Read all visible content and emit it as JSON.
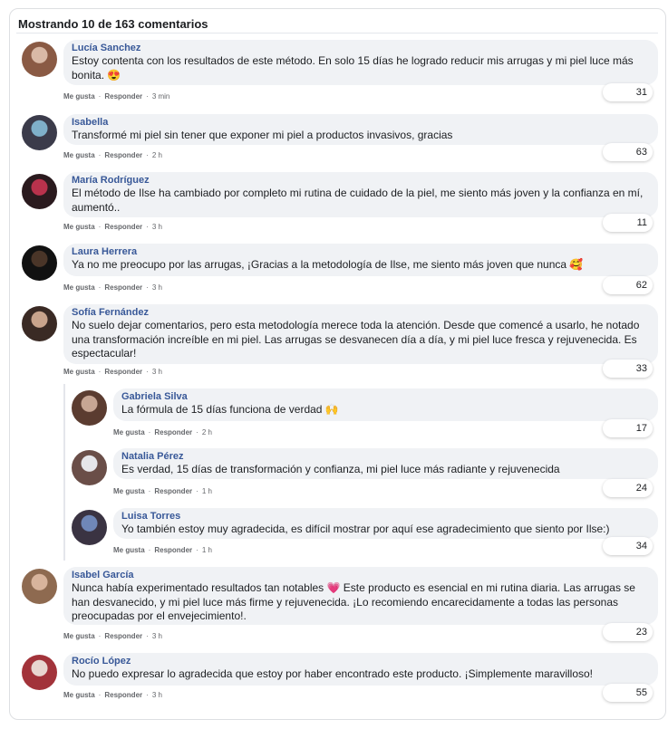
{
  "header": {
    "title": "Mostrando 10 de 163 comentarios"
  },
  "actions": {
    "like": "Me gusta",
    "reply": "Responder",
    "separator": "·"
  },
  "comments": [
    {
      "name": "Lucía Sanchez",
      "lines": [
        "Estoy contenta con los resultados de este método. En solo 15 días he logrado reducir mis arrugas y mi piel luce más",
        "bonita. 😍"
      ],
      "time": "3 min",
      "likes": "31",
      "avatar_colors": [
        "#d9b9a6",
        "#8a5a44"
      ]
    },
    {
      "name": "Isabella",
      "lines": [
        "Transformé mi piel sin tener que exponer mi piel a productos invasivos, gracias"
      ],
      "time": "2 h",
      "likes": "63",
      "avatar_colors": [
        "#7fb0c9",
        "#3b3b4a"
      ]
    },
    {
      "name": "María Rodríguez",
      "lines": [
        "El método de Ilse ha cambiado por completo mi rutina de cuidado de la piel, me siento más joven y la confianza en mí,",
        "aumentó.."
      ],
      "time": "3 h",
      "likes": "11",
      "avatar_colors": [
        "#b8324c",
        "#2a1a1e"
      ]
    },
    {
      "name": "Laura Herrera",
      "lines": [
        "Ya no me preocupo por las arrugas, ¡Gracias a la metodología de Ilse, me siento más joven que nunca 🥰"
      ],
      "time": "3 h",
      "likes": "62",
      "avatar_colors": [
        "#4a3528",
        "#111111"
      ]
    },
    {
      "name": "Sofía Fernández",
      "lines": [
        "No suelo dejar comentarios, pero esta metodología merece toda la atención. Desde que comencé a usarlo, he notado",
        "una transformación increíble en mi piel. Las arrugas se desvanecen día a día, y mi piel luce fresca y rejuvenecida. Es",
        "espectacular!"
      ],
      "time": "3 h",
      "likes": "33",
      "avatar_colors": [
        "#c9a48c",
        "#3a2a24"
      ]
    },
    {
      "name": "Gabriela Silva",
      "lines": [
        "La fórmula de 15 días funciona de verdad 🙌"
      ],
      "time": "2 h",
      "likes": "17",
      "avatar_colors": [
        "#c7a694",
        "#5b3c30"
      ]
    },
    {
      "name": "Natalia Pérez",
      "lines": [
        "Es verdad, 15 días de transformación y confianza, mi piel luce más radiante y rejuvenecida"
      ],
      "time": "1 h",
      "likes": "24",
      "avatar_colors": [
        "#e6e6ea",
        "#6a4e48"
      ]
    },
    {
      "name": "Luisa Torres",
      "lines": [
        "Yo también estoy muy agradecida, es difícil mostrar por aquí ese agradecimiento que siento por Ilse:)"
      ],
      "time": "1 h",
      "likes": "34",
      "avatar_colors": [
        "#6f87b8",
        "#3a3342"
      ]
    },
    {
      "name": "Isabel García",
      "lines": [
        "Nunca había experimentado resultados tan notables 💗 Este producto es esencial en mi rutina diaria. Las arrugas se",
        "han desvanecido, y mi piel luce más firme y rejuvenecida. ¡Lo recomiendo encarecidamente a todas las personas",
        "preocupadas por el envejecimiento!."
      ],
      "time": "3 h",
      "likes": "23",
      "avatar_colors": [
        "#d8b49c",
        "#8e6a50"
      ]
    },
    {
      "name": "Rocío López",
      "lines": [
        "No puedo expresar lo agradecida que estoy por haber encontrado este producto. ¡Simplemente maravilloso!"
      ],
      "time": "3 h",
      "likes": "55",
      "avatar_colors": [
        "#e8d6d0",
        "#a2333a"
      ]
    }
  ]
}
